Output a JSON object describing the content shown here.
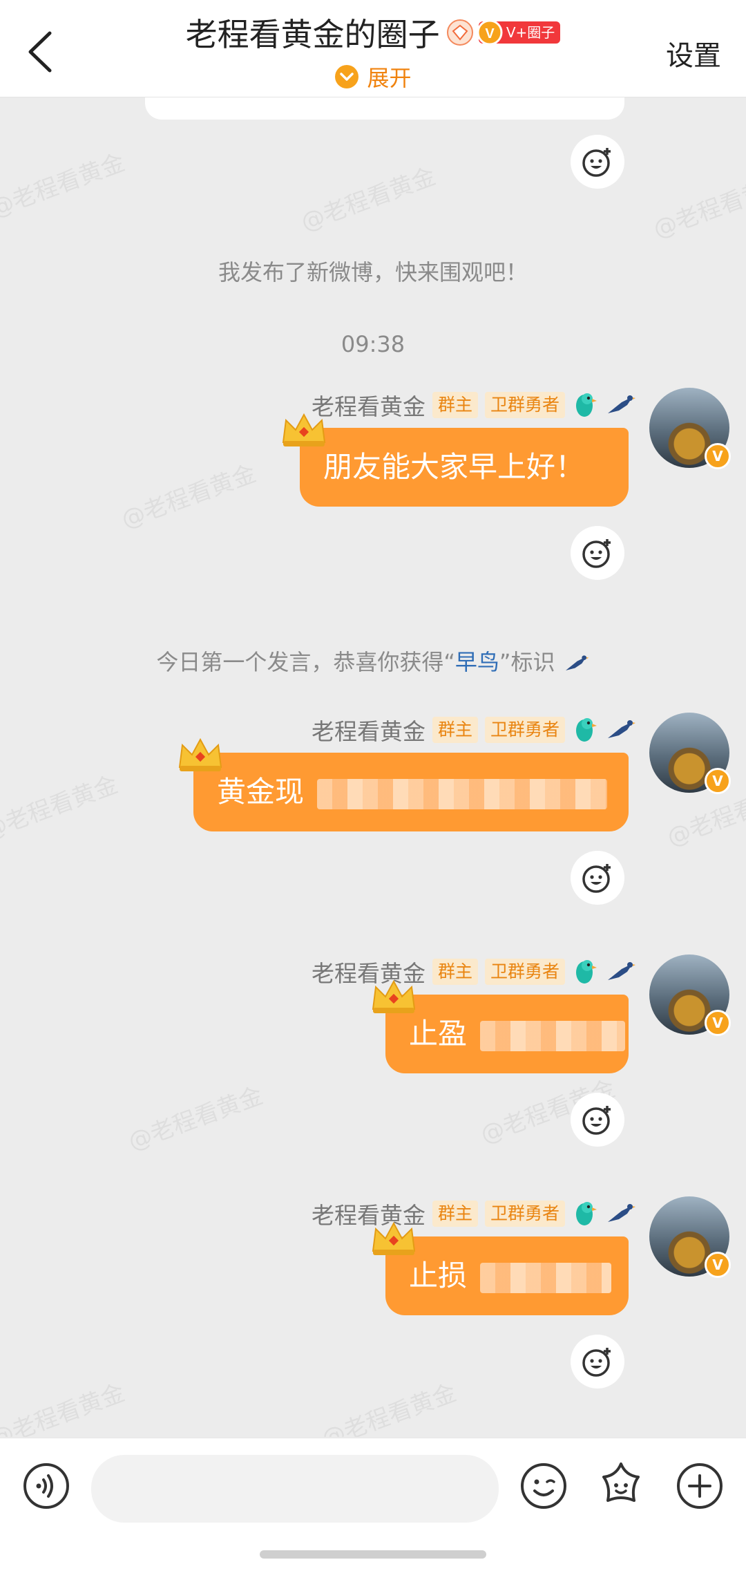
{
  "header": {
    "title": "老程看黄金的圈子",
    "badge_label": "V+圈子",
    "badge_mark": "V",
    "expand_label": "展开",
    "settings_label": "设置"
  },
  "watermark": "@老程看黄金",
  "system_messages": {
    "new_post": "我发布了新微博，快来围观吧！",
    "time": "09:38",
    "early_bird_prefix": "今日第一个发言，恭喜你获得“",
    "early_bird_highlight": "早鸟",
    "early_bird_suffix": "”标识"
  },
  "sender": {
    "name": "老程看黄金",
    "tag_owner": "群主",
    "tag_guard": "卫群勇者",
    "verified_mark": "V"
  },
  "messages": [
    {
      "text": "朋友能大家早上好！"
    },
    {
      "text": "黄金现"
    },
    {
      "text": "止盈"
    },
    {
      "text": "止损"
    }
  ],
  "colors": {
    "bubble": "#ff9a32",
    "accent": "#f0830f",
    "badge_red": "#f1383b",
    "link_blue": "#2f6db6"
  }
}
